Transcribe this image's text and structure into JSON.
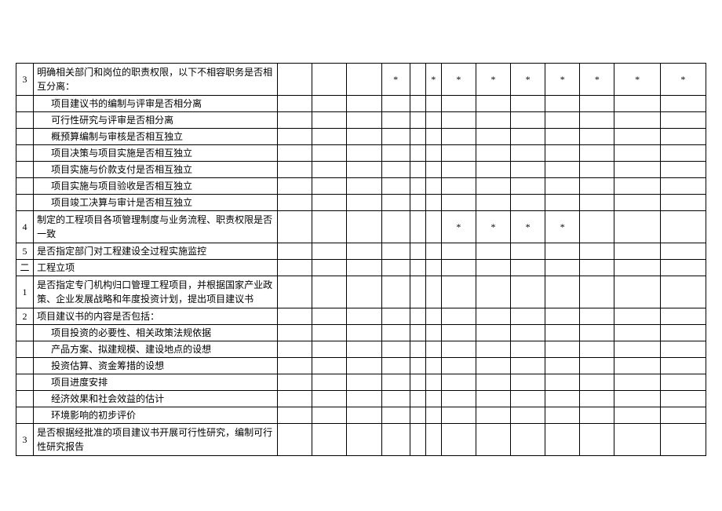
{
  "columns": [
    "c1",
    "c2",
    "c3",
    "c4",
    "c5",
    "c6",
    "c7",
    "c8",
    "c9",
    "c10",
    "c11",
    "c12",
    "c13"
  ],
  "rows": [
    {
      "num": "3",
      "desc": "明确相关部门和岗位的职责权限，以下不相容职务是否相互分离：",
      "indent": false,
      "multi": true,
      "cells": [
        "",
        "",
        "",
        "*",
        "",
        "*",
        "*",
        "*",
        "*",
        "*",
        "*",
        "*",
        "*"
      ]
    },
    {
      "num": "",
      "desc": "项目建议书的编制与评审是否相分离",
      "indent": true,
      "multi": false,
      "cells": [
        "",
        "",
        "",
        "",
        "",
        "",
        "",
        "",
        "",
        "",
        "",
        "",
        ""
      ]
    },
    {
      "num": "",
      "desc": "可行性研究与评审是否相分离",
      "indent": true,
      "multi": false,
      "cells": [
        "",
        "",
        "",
        "",
        "",
        "",
        "",
        "",
        "",
        "",
        "",
        "",
        ""
      ]
    },
    {
      "num": "",
      "desc": "概预算编制与审核是否相互独立",
      "indent": true,
      "multi": false,
      "cells": [
        "",
        "",
        "",
        "",
        "",
        "",
        "",
        "",
        "",
        "",
        "",
        "",
        ""
      ]
    },
    {
      "num": "",
      "desc": "项目决策与项目实施是否相互独立",
      "indent": true,
      "multi": false,
      "cells": [
        "",
        "",
        "",
        "",
        "",
        "",
        "",
        "",
        "",
        "",
        "",
        "",
        ""
      ]
    },
    {
      "num": "",
      "desc": "项目实施与价款支付是否相互独立",
      "indent": true,
      "multi": false,
      "cells": [
        "",
        "",
        "",
        "",
        "",
        "",
        "",
        "",
        "",
        "",
        "",
        "",
        ""
      ]
    },
    {
      "num": "",
      "desc": "项目实施与项目验收是否相互独立",
      "indent": true,
      "multi": false,
      "cells": [
        "",
        "",
        "",
        "",
        "",
        "",
        "",
        "",
        "",
        "",
        "",
        "",
        ""
      ]
    },
    {
      "num": "",
      "desc": "项目竣工决算与审计是否相互独立",
      "indent": true,
      "multi": false,
      "cells": [
        "",
        "",
        "",
        "",
        "",
        "",
        "",
        "",
        "",
        "",
        "",
        "",
        ""
      ]
    },
    {
      "num": "4",
      "desc": "制定的工程项目各项管理制度与业务流程、职责权限是否一致",
      "indent": false,
      "multi": true,
      "cells": [
        "",
        "",
        "",
        "",
        "",
        "",
        "*",
        "*",
        "*",
        "*",
        "",
        "",
        " "
      ]
    },
    {
      "num": "5",
      "desc": "是否指定部门对工程建设全过程实施监控",
      "indent": false,
      "multi": false,
      "cells": [
        "",
        "",
        "",
        "",
        "",
        "",
        "",
        "",
        "",
        "",
        "",
        "",
        ""
      ]
    },
    {
      "num": "二",
      "desc": "工程立项",
      "indent": false,
      "multi": false,
      "cells": [
        "",
        "",
        "",
        "",
        "",
        "",
        "",
        "",
        "",
        "",
        "",
        "",
        ""
      ]
    },
    {
      "num": "1",
      "desc": "是否指定专门机构归口管理工程项目，并根据国家产业政策、企业发展战略和年度投资计划，提出项目建议书",
      "indent": false,
      "multi": true,
      "cells": [
        "",
        "",
        "",
        "",
        "",
        "",
        "",
        "",
        "",
        "",
        "",
        "",
        ""
      ]
    },
    {
      "num": "2",
      "desc": "项目建议书的内容是否包括：",
      "indent": false,
      "multi": false,
      "cells": [
        "",
        "",
        "",
        "",
        "",
        "",
        "",
        "",
        "",
        "",
        "",
        "",
        ""
      ]
    },
    {
      "num": "",
      "desc": "项目投资的必要性、相关政策法规依据",
      "indent": true,
      "multi": false,
      "cells": [
        "",
        "",
        "",
        "",
        "",
        "",
        "",
        "",
        "",
        "",
        "",
        "",
        ""
      ]
    },
    {
      "num": "",
      "desc": "产品方案、拟建规模、建设地点的设想",
      "indent": true,
      "multi": false,
      "cells": [
        "",
        "",
        "",
        "",
        "",
        "",
        "",
        "",
        "",
        "",
        "",
        "",
        ""
      ]
    },
    {
      "num": "",
      "desc": "投资估算、资金筹措的设想",
      "indent": true,
      "multi": false,
      "cells": [
        "",
        "",
        "",
        "",
        "",
        "",
        "",
        "",
        "",
        "",
        "",
        "",
        ""
      ]
    },
    {
      "num": "",
      "desc": "项目进度安排",
      "indent": true,
      "multi": false,
      "cells": [
        "",
        "",
        "",
        "",
        "",
        "",
        "",
        "",
        "",
        "",
        "",
        "",
        ""
      ]
    },
    {
      "num": "",
      "desc": "经济效果和社会效益的估计",
      "indent": true,
      "multi": false,
      "cells": [
        "",
        "",
        "",
        "",
        "",
        "",
        "",
        "",
        "",
        "",
        "",
        "",
        ""
      ]
    },
    {
      "num": "",
      "desc": "环境影响的初步评价",
      "indent": true,
      "multi": false,
      "cells": [
        "",
        "",
        "",
        "",
        "",
        "",
        "",
        "",
        "",
        "",
        "",
        "",
        ""
      ]
    },
    {
      "num": "3",
      "desc": "是否根据经批准的项目建议书开展可行性研究，编制可行性研究报告",
      "indent": false,
      "multi": true,
      "cells": [
        "",
        "",
        "",
        "",
        "",
        "",
        "",
        "",
        "",
        "",
        "",
        "",
        ""
      ]
    }
  ]
}
